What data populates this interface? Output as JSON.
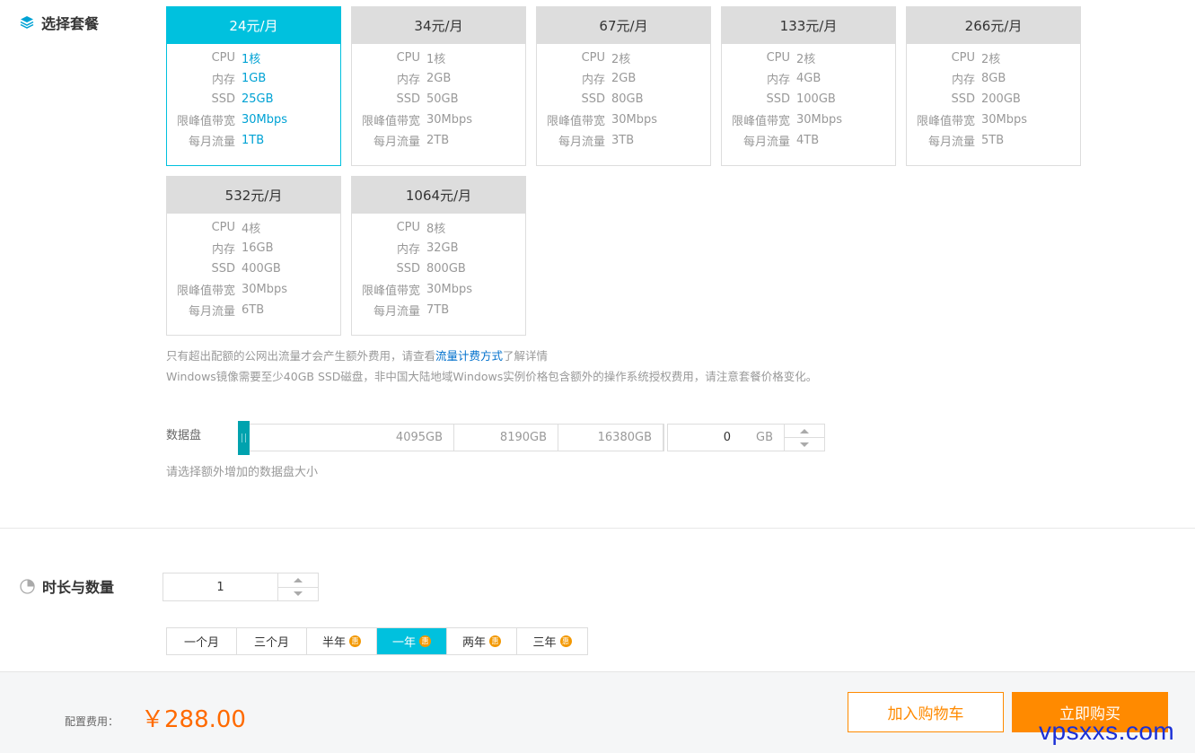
{
  "sections": {
    "package_title": "选择套餐",
    "duration_title": "时长与数量"
  },
  "plan_labels": {
    "cpu": "CPU",
    "memory": "内存",
    "ssd": "SSD",
    "bandwidth": "限峰值带宽",
    "traffic": "每月流量"
  },
  "plans": [
    {
      "price": "24元/月",
      "cpu": "1核",
      "memory": "1GB",
      "ssd": "25GB",
      "bandwidth": "30Mbps",
      "traffic": "1TB",
      "selected": true
    },
    {
      "price": "34元/月",
      "cpu": "1核",
      "memory": "2GB",
      "ssd": "50GB",
      "bandwidth": "30Mbps",
      "traffic": "2TB",
      "selected": false
    },
    {
      "price": "67元/月",
      "cpu": "2核",
      "memory": "2GB",
      "ssd": "80GB",
      "bandwidth": "30Mbps",
      "traffic": "3TB",
      "selected": false
    },
    {
      "price": "133元/月",
      "cpu": "2核",
      "memory": "4GB",
      "ssd": "100GB",
      "bandwidth": "30Mbps",
      "traffic": "4TB",
      "selected": false
    },
    {
      "price": "266元/月",
      "cpu": "2核",
      "memory": "8GB",
      "ssd": "200GB",
      "bandwidth": "30Mbps",
      "traffic": "5TB",
      "selected": false
    },
    {
      "price": "532元/月",
      "cpu": "4核",
      "memory": "16GB",
      "ssd": "400GB",
      "bandwidth": "30Mbps",
      "traffic": "6TB",
      "selected": false
    },
    {
      "price": "1064元/月",
      "cpu": "8核",
      "memory": "32GB",
      "ssd": "800GB",
      "bandwidth": "30Mbps",
      "traffic": "7TB",
      "selected": false
    }
  ],
  "notes": {
    "line1_before": "只有超出配额的公网出流量才会产生额外费用，请查看",
    "line1_link": "流量计费方式",
    "line1_after": "了解详情",
    "line2": "Windows镜像需要至少40GB SSD磁盘，非中国大陆地域Windows实例价格包含额外的操作系统授权费用，请注意套餐价格变化。"
  },
  "data_disk": {
    "label": "数据盘",
    "marks": [
      "4095GB",
      "8190GB",
      "16380GB"
    ],
    "value": "0",
    "unit": "GB",
    "hint": "请选择额外增加的数据盘大小"
  },
  "quantity": {
    "value": "1"
  },
  "durations": [
    {
      "label": "一个月",
      "badge": "",
      "selected": false
    },
    {
      "label": "三个月",
      "badge": "",
      "selected": false
    },
    {
      "label": "半年",
      "badge": "惠",
      "selected": false
    },
    {
      "label": "一年",
      "badge": "惠",
      "selected": true
    },
    {
      "label": "两年",
      "badge": "惠",
      "selected": false
    },
    {
      "label": "三年",
      "badge": "惠",
      "selected": false
    }
  ],
  "footer": {
    "fee_label": "配置费用：",
    "fee_value": "￥288.00",
    "cart_button": "加入购物车",
    "buy_button": "立即购买"
  },
  "watermark": "vpsxxs.com",
  "colors": {
    "accent": "#00c1de",
    "orange": "#ff8a00",
    "price": "#ff6a00"
  }
}
